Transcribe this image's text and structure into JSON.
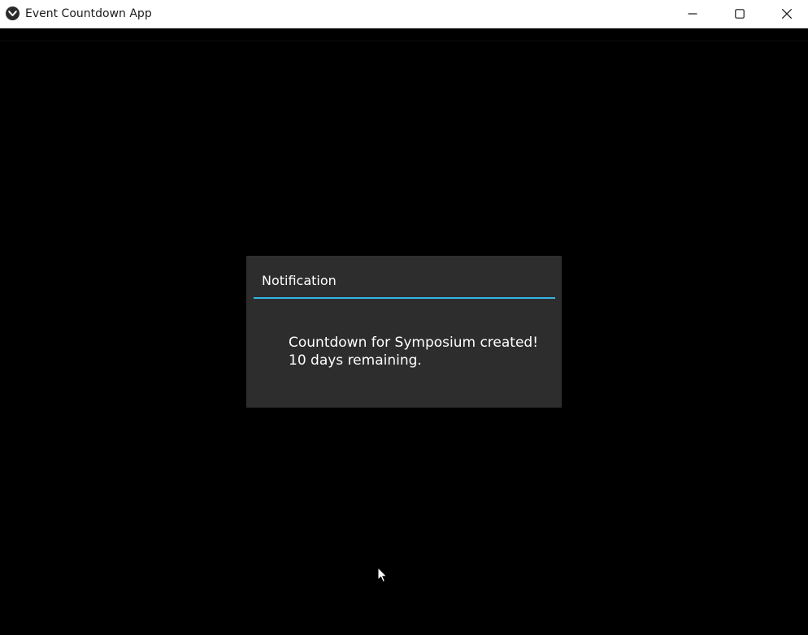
{
  "window": {
    "title": "Event Countdown App",
    "controls": {
      "minimize_icon": "minimize-icon",
      "maximize_icon": "maximize-icon",
      "close_icon": "close-icon"
    }
  },
  "dialog": {
    "title": "Notification",
    "message_lines": [
      "Countdown for Symposium created!",
      "10 days remaining."
    ],
    "accent_color": "#33b5e5"
  },
  "colors": {
    "background": "#000000",
    "dialog_background": "#2d2d2d",
    "titlebar": "#ffffff"
  }
}
